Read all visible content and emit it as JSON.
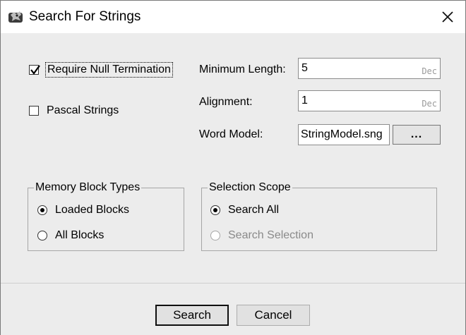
{
  "window": {
    "title": "Search For Strings",
    "icon": "dragon-app-icon"
  },
  "options": {
    "require_null": {
      "label": "Require Null Termination",
      "checked": true
    },
    "pascal": {
      "label": "Pascal Strings",
      "checked": false
    }
  },
  "fields": {
    "min_length": {
      "label": "Minimum Length:",
      "value": "5",
      "unit": "Dec"
    },
    "alignment": {
      "label": "Alignment:",
      "value": "1",
      "unit": "Dec"
    },
    "word_model": {
      "label": "Word Model:",
      "value": "StringModel.sng",
      "browse": "..."
    }
  },
  "memory_block_types": {
    "title": "Memory Block Types",
    "options": [
      {
        "label": "Loaded Blocks",
        "selected": true
      },
      {
        "label": "All Blocks",
        "selected": false
      }
    ]
  },
  "selection_scope": {
    "title": "Selection Scope",
    "options": [
      {
        "label": "Search All",
        "selected": true,
        "enabled": true
      },
      {
        "label": "Search Selection",
        "selected": false,
        "enabled": false
      }
    ]
  },
  "buttons": {
    "search": "Search",
    "cancel": "Cancel"
  }
}
